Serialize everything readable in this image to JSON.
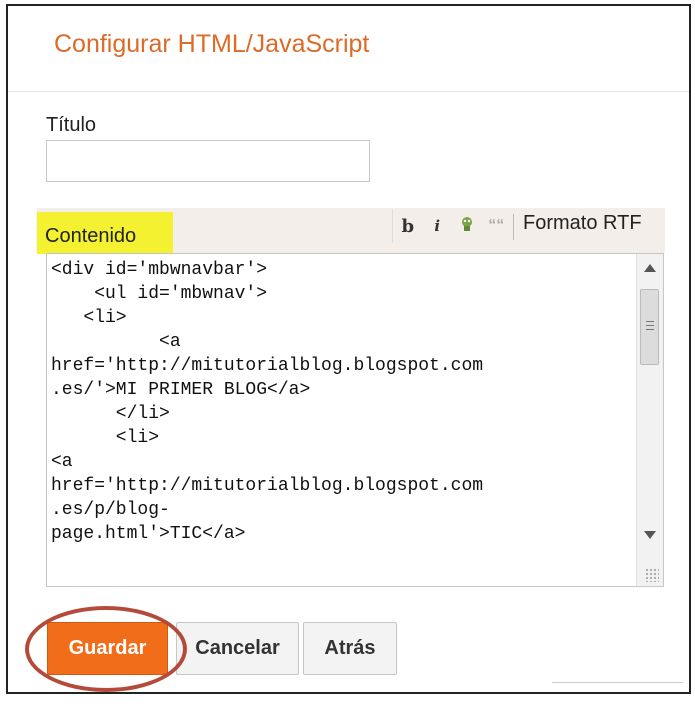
{
  "dialog": {
    "title": "Configurar HTML/JavaScript"
  },
  "form": {
    "title_label": "Título",
    "title_value": "",
    "content_label": "Contenido"
  },
  "toolbar": {
    "bold_label": "b",
    "italic_label": "i",
    "link_icon": "link-icon",
    "quote_label": "““",
    "rich_text_label": "Formato RTF"
  },
  "editor": {
    "code": "<div id='mbwnavbar'>\n    <ul id='mbwnav'>\n   <li>\n          <a\nhref='http://mitutorialblog.blogspot.com\n.es/'>MI PRIMER BLOG</a>\n      </li>\n      <li>\n<a\nhref='http://mitutorialblog.blogspot.com\n.es/p/blog-\npage.html'>TIC</a>"
  },
  "buttons": {
    "save_label": "Guardar",
    "cancel_label": "Cancelar",
    "back_label": "Atrás"
  },
  "colors": {
    "accent": "#dd6a27",
    "save_button": "#f26d1a",
    "highlight": "#f4f131",
    "annotation": "#b44b3a"
  }
}
